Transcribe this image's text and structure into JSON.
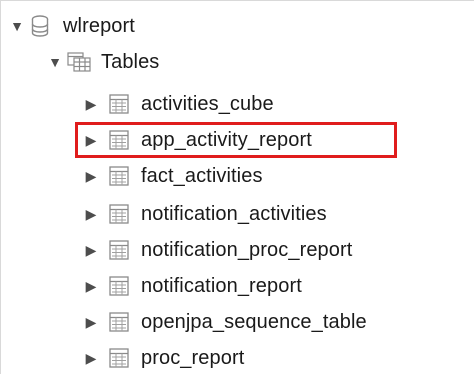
{
  "tree": {
    "database": {
      "label": "wlreport",
      "icon": "database-icon",
      "expanded": true
    },
    "folder": {
      "label": "Tables",
      "icon": "tables-folder-icon",
      "expanded": true
    },
    "tables": [
      {
        "label": "activities_cube",
        "icon": "table-icon"
      },
      {
        "label": "app_activity_report",
        "icon": "table-icon",
        "highlighted": true
      },
      {
        "label": "fact_activities",
        "icon": "table-icon"
      },
      {
        "label": "notification_activities",
        "icon": "table-icon"
      },
      {
        "label": "notification_proc_report",
        "icon": "table-icon"
      },
      {
        "label": "notification_report",
        "icon": "table-icon"
      },
      {
        "label": "openjpa_sequence_table",
        "icon": "table-icon"
      },
      {
        "label": "proc_report",
        "icon": "table-icon"
      }
    ]
  },
  "colors": {
    "highlight_border": "#e01d1d",
    "arrow": "#4d4d4d",
    "icon_stroke": "#8a8a8a"
  }
}
